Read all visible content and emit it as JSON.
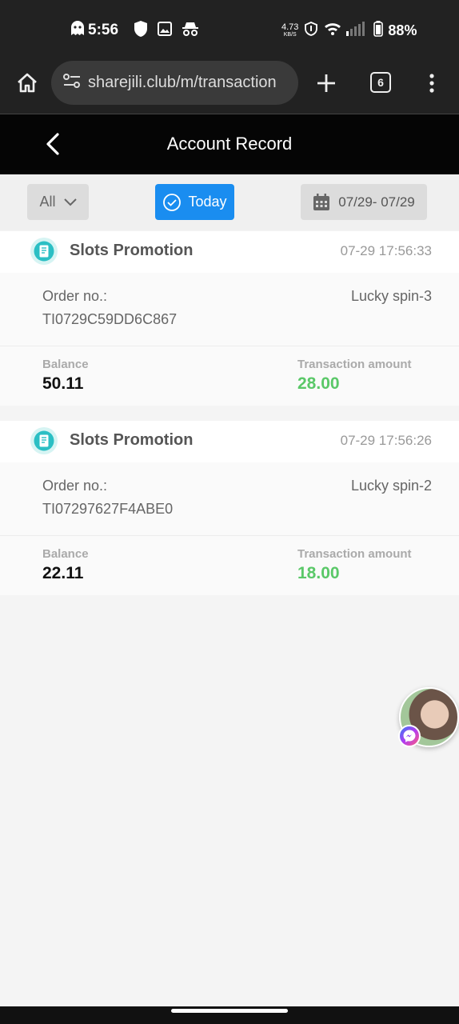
{
  "status_bar": {
    "time": "5:56",
    "net_speed_value": "4.73",
    "net_speed_unit": "KB/S",
    "battery": "88%",
    "icons": [
      "ghost-icon",
      "shield-icon",
      "image-icon",
      "incognito-icon",
      "data-saver-icon",
      "wifi-icon",
      "signal-icon",
      "battery-icon"
    ]
  },
  "browser": {
    "url": "sharejili.club/m/transaction",
    "tab_count": "6"
  },
  "header": {
    "title": "Account Record"
  },
  "filters": {
    "type_label": "All",
    "today_label": "Today",
    "date_range": "07/29- 07/29"
  },
  "records": [
    {
      "title": "Slots Promotion",
      "time": "07-29 17:56:33",
      "order_label": "Order no.:",
      "order_no": "TI0729C59DD6C867",
      "game": "Lucky spin-3",
      "balance_label": "Balance",
      "balance": "50.11",
      "amount_label": "Transaction amount",
      "amount": "28.00"
    },
    {
      "title": "Slots Promotion",
      "time": "07-29 17:56:26",
      "order_label": "Order no.:",
      "order_no": "TI07297627F4ABE0",
      "game": "Lucky spin-2",
      "balance_label": "Balance",
      "balance": "22.11",
      "amount_label": "Transaction amount",
      "amount": "18.00"
    }
  ],
  "colors": {
    "accent": "#1a8df0",
    "amount": "#5ac868",
    "header_bg": "#050505"
  }
}
